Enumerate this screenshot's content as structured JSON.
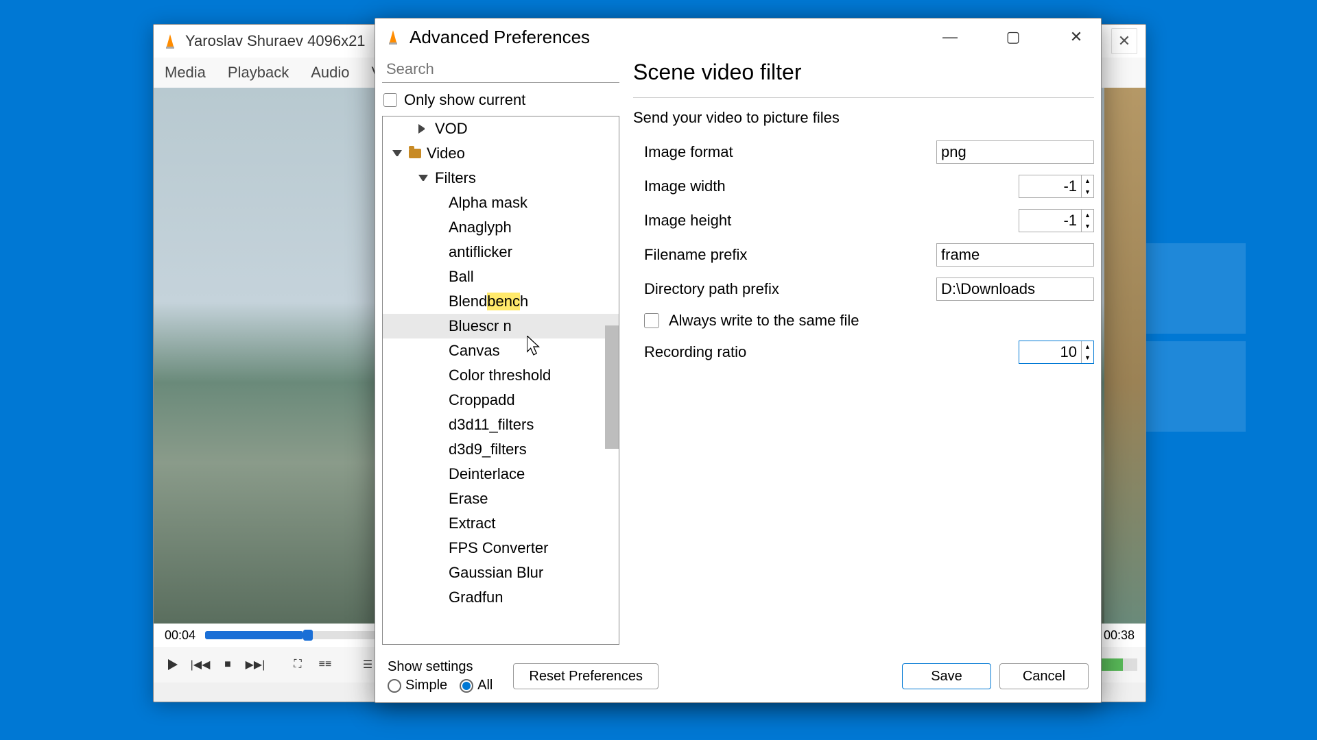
{
  "vlc": {
    "title": "Yaroslav Shuraev 4096x21",
    "menu": {
      "media": "Media",
      "playback": "Playback",
      "audio": "Audio",
      "video": "Vi"
    },
    "time_current": "00:04",
    "time_total": "00:38"
  },
  "prefs": {
    "title": "Advanced Preferences",
    "search_placeholder": "Search",
    "only_show_current": "Only show current",
    "tree": {
      "vod": "VOD",
      "video": "Video",
      "filters": "Filters",
      "items": [
        "Alpha mask",
        "Anaglyph",
        "antiflicker",
        "Ball",
        "Blendbench",
        "Bluescreen",
        "Canvas",
        "Color threshold",
        "Croppadd",
        "d3d11_filters",
        "d3d9_filters",
        "Deinterlace",
        "Erase",
        "Extract",
        "FPS Converter",
        "Gaussian Blur",
        "Gradfun"
      ]
    },
    "panel": {
      "heading": "Scene video filter",
      "subtitle": "Send your video to picture files",
      "image_format": {
        "label": "Image format",
        "value": "png"
      },
      "image_width": {
        "label": "Image width",
        "value": "-1"
      },
      "image_height": {
        "label": "Image height",
        "value": "-1"
      },
      "filename_prefix": {
        "label": "Filename prefix",
        "value": "frame"
      },
      "dir_prefix": {
        "label": "Directory path prefix",
        "value": "D:\\Downloads"
      },
      "always_same": "Always write to the same file",
      "recording_ratio": {
        "label": "Recording ratio",
        "value": "10"
      }
    },
    "footer": {
      "show_settings": "Show settings",
      "simple": "Simple",
      "all": "All",
      "reset": "Reset Preferences",
      "save": "Save",
      "cancel": "Cancel"
    }
  }
}
